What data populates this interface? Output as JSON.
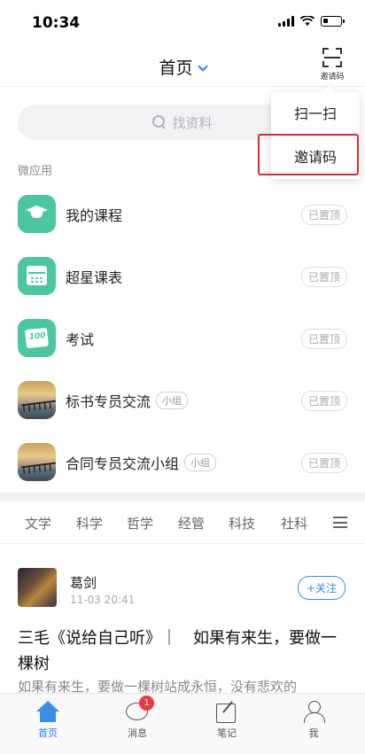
{
  "status_bar": {
    "time": "10:34",
    "battery_level": 0.3
  },
  "header": {
    "title": "首页",
    "scan_label": "邀请码"
  },
  "search": {
    "placeholder": "找资料"
  },
  "micro_apps": {
    "section_label": "微应用",
    "items": [
      {
        "name": "我的课程",
        "pinned_label": "已置顶",
        "icon": "graduation-cap-icon"
      },
      {
        "name": "超星课表",
        "pinned_label": "已置顶",
        "icon": "calendar-icon"
      },
      {
        "name": "考试",
        "pinned_label": "已置顶",
        "icon": "exam-paper-icon",
        "icon_text": "100"
      },
      {
        "name": "标书专员交流",
        "tag": "小组",
        "pinned_label": "已置顶",
        "icon": "group-photo-icon"
      },
      {
        "name": "合同专员交流小组",
        "tag": "小组",
        "pinned_label": "已置顶",
        "icon": "group-photo-icon"
      }
    ]
  },
  "categories": [
    "文学",
    "科学",
    "哲学",
    "经管",
    "科技",
    "社科"
  ],
  "feed": {
    "author": "葛剑",
    "time": "11-03 20:41",
    "follow_label": "+关注",
    "title": "三毛《说给自己听》｜　如果有来生，要做一棵树",
    "snippet": "如果有来生，要做一棵树站成永恒，没有悲欢的"
  },
  "tabbar": {
    "items": [
      {
        "label": "首页",
        "icon": "home-icon",
        "active": true
      },
      {
        "label": "消息",
        "icon": "message-icon",
        "badge": "1"
      },
      {
        "label": "笔记",
        "icon": "note-icon"
      },
      {
        "label": "我",
        "icon": "profile-icon"
      }
    ]
  },
  "popup_menu": {
    "items": [
      {
        "label": "扫一扫"
      },
      {
        "label": "邀请码",
        "highlighted": true
      }
    ]
  },
  "colors": {
    "accent": "#2b7cf6",
    "app_green": "#4bc6a0",
    "highlight_red": "#e0282e",
    "badge_red": "#f0383e"
  }
}
